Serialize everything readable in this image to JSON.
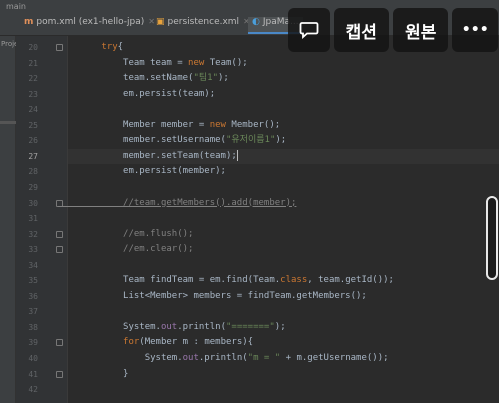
{
  "window": {
    "title": "main"
  },
  "tabs": [
    {
      "icon": "m",
      "label": "pom.xml (ex1-hello-jpa)",
      "active": false
    },
    {
      "icon": "▣",
      "label": "persistence.xml",
      "active": false
    },
    {
      "icon": "◐",
      "label": "JpaMa...",
      "active": true
    }
  ],
  "project_strip_label": "Proje",
  "overlay": {
    "caption_label": "캡션",
    "original_label": "원본",
    "more_label": "•••"
  },
  "editor": {
    "current_line": "27",
    "lines": [
      {
        "n": "20",
        "fold": true,
        "segs": [
          [
            "t",
            "        "
          ],
          [
            "kw",
            "try"
          ],
          [
            "t",
            "{"
          ]
        ]
      },
      {
        "n": "21",
        "fold": false,
        "segs": [
          [
            "t",
            "            Team team = "
          ],
          [
            "kw",
            "new"
          ],
          [
            "t",
            " Team();"
          ]
        ]
      },
      {
        "n": "22",
        "fold": false,
        "segs": [
          [
            "t",
            "            team.setName("
          ],
          [
            "str",
            "\"팀1\""
          ],
          [
            "t",
            ");"
          ]
        ]
      },
      {
        "n": "23",
        "fold": false,
        "segs": [
          [
            "t",
            "            em.persist(team);"
          ]
        ]
      },
      {
        "n": "24",
        "fold": false,
        "segs": []
      },
      {
        "n": "25",
        "fold": false,
        "segs": [
          [
            "t",
            "            Member member = "
          ],
          [
            "kw",
            "new"
          ],
          [
            "t",
            " Member();"
          ]
        ]
      },
      {
        "n": "26",
        "fold": false,
        "segs": [
          [
            "t",
            "            member.setUsername("
          ],
          [
            "str",
            "\"유저이름1\""
          ],
          [
            "t",
            ");"
          ]
        ]
      },
      {
        "n": "27",
        "fold": false,
        "segs": [
          [
            "t",
            "            member.setTeam(team);"
          ]
        ]
      },
      {
        "n": "28",
        "fold": false,
        "segs": [
          [
            "t",
            "            em.persist(member);"
          ]
        ]
      },
      {
        "n": "29",
        "fold": false,
        "segs": []
      },
      {
        "n": "30",
        "fold": true,
        "segs": [
          [
            "cmtu",
            "            //team.getMembers().add(member);"
          ]
        ]
      },
      {
        "n": "31",
        "fold": false,
        "segs": []
      },
      {
        "n": "32",
        "fold": true,
        "segs": [
          [
            "cmt",
            "            //em.flush();"
          ]
        ]
      },
      {
        "n": "33",
        "fold": true,
        "segs": [
          [
            "cmt",
            "            //em.clear();"
          ]
        ]
      },
      {
        "n": "34",
        "fold": false,
        "segs": []
      },
      {
        "n": "35",
        "fold": false,
        "segs": [
          [
            "t",
            "            Team findTeam = em.find(Team."
          ],
          [
            "kw",
            "class"
          ],
          [
            "t",
            ", team.getId());"
          ]
        ]
      },
      {
        "n": "36",
        "fold": false,
        "segs": [
          [
            "t",
            "            List<Member> members = findTeam.getMembers();"
          ]
        ]
      },
      {
        "n": "37",
        "fold": false,
        "segs": []
      },
      {
        "n": "38",
        "fold": false,
        "segs": [
          [
            "t",
            "            System."
          ],
          [
            "fld",
            "out"
          ],
          [
            "t",
            ".println("
          ],
          [
            "str",
            "\"=======\""
          ],
          [
            "t",
            ");"
          ]
        ]
      },
      {
        "n": "39",
        "fold": true,
        "segs": [
          [
            "t",
            "            "
          ],
          [
            "kw",
            "for"
          ],
          [
            "t",
            "(Member m : members){"
          ]
        ]
      },
      {
        "n": "40",
        "fold": false,
        "segs": [
          [
            "t",
            "                System."
          ],
          [
            "fld",
            "out"
          ],
          [
            "t",
            ".println("
          ],
          [
            "str",
            "\"m = \""
          ],
          [
            "t",
            " + m.getUsername());"
          ]
        ]
      },
      {
        "n": "41",
        "fold": true,
        "segs": [
          [
            "t",
            "            }"
          ]
        ]
      },
      {
        "n": "42",
        "fold": false,
        "segs": []
      }
    ]
  }
}
